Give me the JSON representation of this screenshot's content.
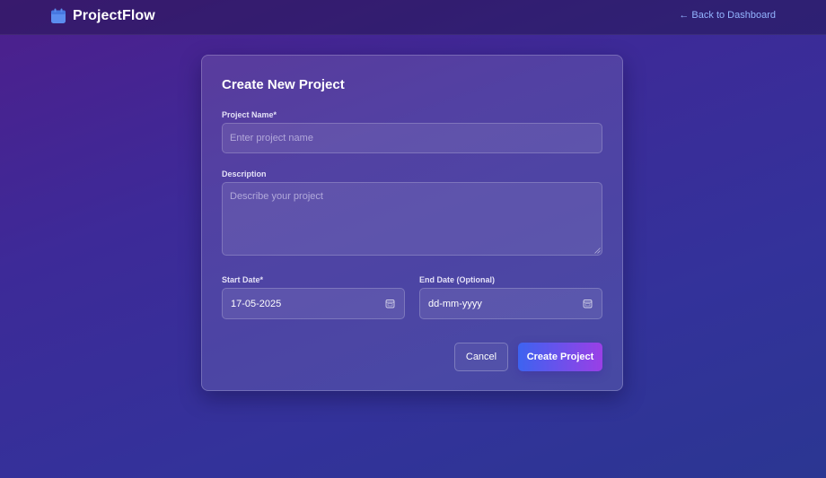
{
  "nav": {
    "brand": "ProjectFlow",
    "back_link": "← Back to Dashboard"
  },
  "form": {
    "title": "Create New Project",
    "project_name": {
      "label": "Project Name*",
      "placeholder": "Enter project name",
      "value": ""
    },
    "description": {
      "label": "Description",
      "placeholder": "Describe your project",
      "value": ""
    },
    "start_date": {
      "label": "Start Date*",
      "value": "17-05-2025"
    },
    "end_date": {
      "label": "End Date (Optional)",
      "value": "dd-mm-yyyy"
    },
    "cancel_label": "Cancel",
    "submit_label": "Create Project"
  },
  "icons": {
    "brand": "calendar-icon",
    "date_picker": "calendar-icon"
  },
  "colors": {
    "accent_link": "#93b4ff",
    "brand_icon": "#5b8def",
    "button_gradient_start": "#3d63f0",
    "button_gradient_end": "#9a3fe6"
  }
}
